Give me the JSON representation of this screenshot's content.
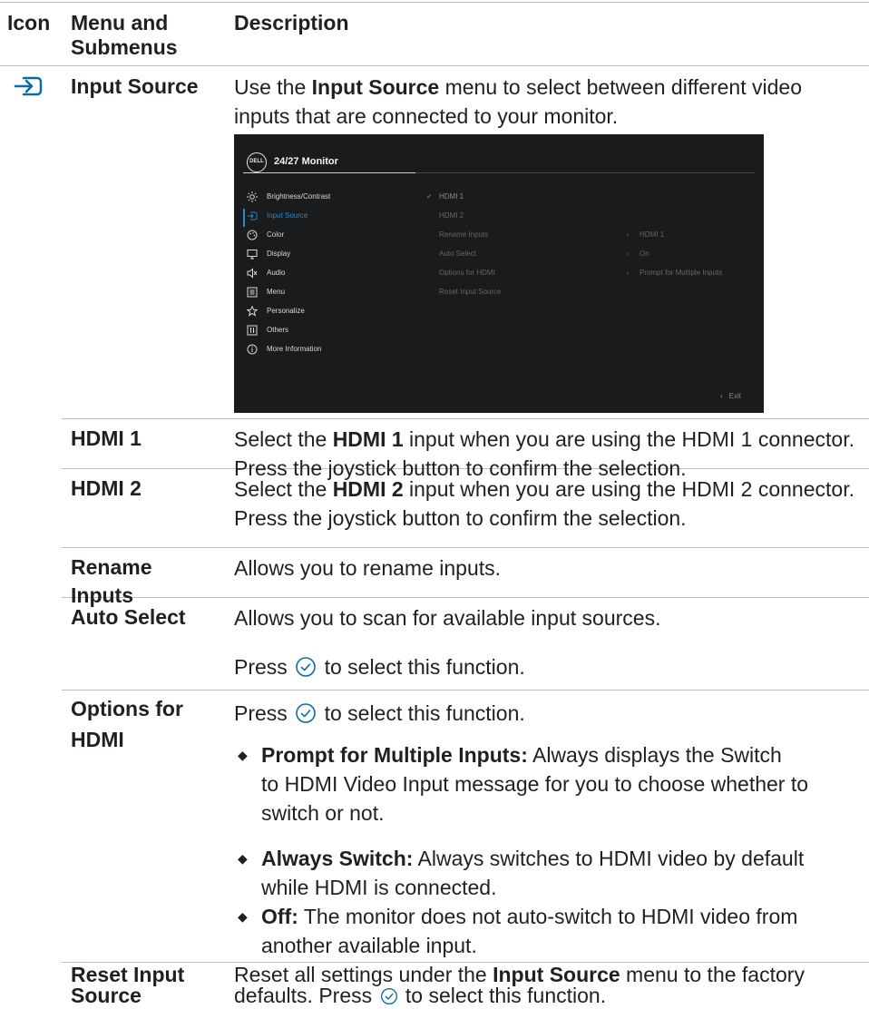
{
  "header": {
    "col1": "Icon",
    "col2": "Menu and Submenus",
    "col3": "Description"
  },
  "input_source": {
    "icon": "input-source-icon",
    "label": "Input Source",
    "desc_pre": "Use the ",
    "desc_bold": "Input Source",
    "desc_post": " menu to select between different video inputs that are connected to your monitor."
  },
  "osd": {
    "logo": "DELL",
    "title": "24/27 Monitor",
    "menu_items": [
      {
        "label": "Brightness/Contrast",
        "icon": "brightness-icon"
      },
      {
        "label": "Input Source",
        "icon": "input-source-icon"
      },
      {
        "label": "Color",
        "icon": "color-palette-icon"
      },
      {
        "label": "Display",
        "icon": "display-icon"
      },
      {
        "label": "Audio",
        "icon": "speaker-icon"
      },
      {
        "label": "Menu",
        "icon": "menu-icon"
      },
      {
        "label": "Personalize",
        "icon": "star-icon"
      },
      {
        "label": "Others",
        "icon": "others-icon"
      },
      {
        "label": "More Information",
        "icon": "info-icon"
      }
    ],
    "submenu_items": [
      "HDMI 1",
      "HDMI 2",
      "Rename Inputs",
      "Auto Select",
      "Options for HDMI",
      "Reset Input Source"
    ],
    "submenu_values": [
      "HDMI 1",
      "On",
      "Prompt for Multiple Inputs"
    ],
    "exit_label": "Exit",
    "colors": {
      "accent": "#2a87c8",
      "background": "#1a1b1d"
    }
  },
  "rows": {
    "hdmi1": {
      "label": "HDMI 1",
      "pre": "Select the ",
      "bold": "HDMI 1",
      "post": " input when you are using the HDMI 1 connector. Press the joystick button to confirm the selection."
    },
    "hdmi2": {
      "label": "HDMI 2",
      "pre": "Select the ",
      "bold": "HDMI 2",
      "post": " input when you are using the HDMI 2 connector. Press the joystick button to confirm the selection."
    },
    "rename": {
      "label_line1": "Rename",
      "label_line2": "Inputs",
      "desc": "Allows you to rename inputs."
    },
    "auto_select": {
      "label": "Auto Select",
      "desc": "Allows you to scan for available input sources.",
      "press_pre": "Press ",
      "press_post": " to select this function."
    },
    "options_hdmi": {
      "label_line1": "Options for",
      "label_line2": "HDMI",
      "press_pre": "Press ",
      "press_post": " to select this function.",
      "bullets": [
        {
          "bold": "Prompt for Multiple Inputs:",
          "line1": " Always displays the Switch",
          "line2": "to HDMI Video Input message for you to choose whether to",
          "line3": "switch or not."
        },
        {
          "bold": "Always Switch:",
          "line1": " Always switches to HDMI video by default",
          "line2": "while HDMI is connected."
        },
        {
          "bold": "Off:",
          "line1": " The monitor does not auto-switch to HDMI video from",
          "line2": "another available input."
        }
      ]
    },
    "reset": {
      "label_line1": "Reset Input",
      "label_line2": "Source",
      "pre": "Reset all settings under the ",
      "bold": "Input Source",
      "post1": " menu to the factory",
      "post2_pre": "defaults. Press ",
      "post2_post": " to select this function."
    }
  }
}
